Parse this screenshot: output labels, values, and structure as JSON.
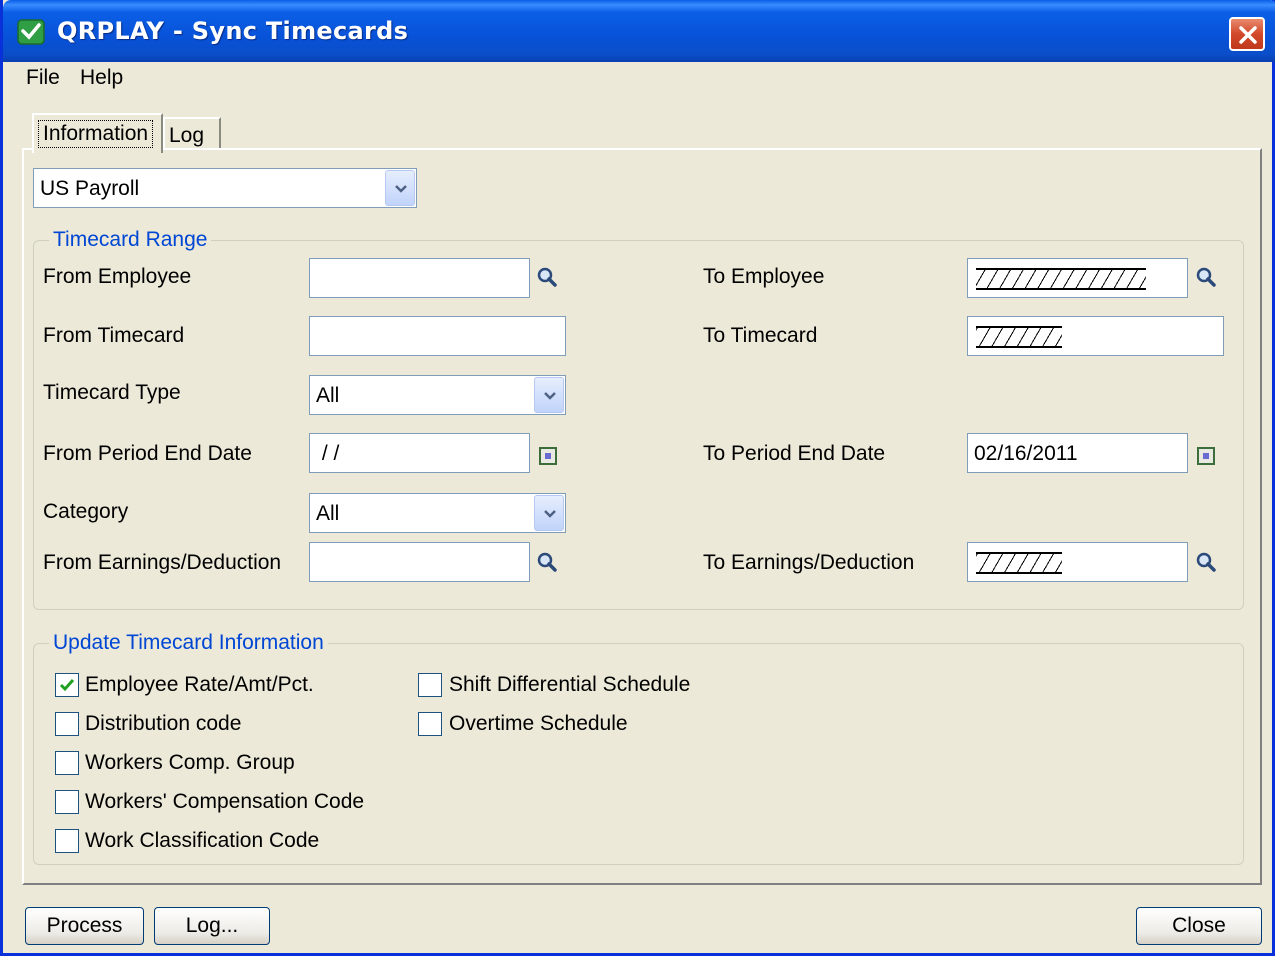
{
  "window": {
    "title": "QRPLAY - Sync Timecards",
    "app_icon": "sage-check-icon",
    "close_icon": "close-icon"
  },
  "menu": {
    "items": [
      "File",
      "Help"
    ]
  },
  "tabs": [
    {
      "label": "Information",
      "active": true
    },
    {
      "label": "Log",
      "active": false
    }
  ],
  "payroll_select": {
    "value": "US Payroll"
  },
  "timecard_range": {
    "legend": "Timecard Range",
    "from_employee": {
      "label": "From Employee",
      "value": ""
    },
    "to_employee": {
      "label": "To Employee",
      "value": "ZZZZZZZZZZZZ"
    },
    "from_timecard": {
      "label": "From Timecard",
      "value": ""
    },
    "to_timecard": {
      "label": "To Timecard",
      "value": "ZZZZZZ"
    },
    "timecard_type": {
      "label": "Timecard Type",
      "value": "All"
    },
    "from_period_end_date": {
      "label": "From Period End Date",
      "value": " / /"
    },
    "to_period_end_date": {
      "label": "To Period End Date",
      "value": "02/16/2011"
    },
    "category": {
      "label": "Category",
      "value": "All"
    },
    "from_earnings": {
      "label": "From Earnings/Deduction",
      "value": ""
    },
    "to_earnings": {
      "label": "To Earnings/Deduction",
      "value": "ZZZZZZ"
    }
  },
  "update_info": {
    "legend": "Update Timecard Information",
    "options": [
      {
        "label": "Employee Rate/Amt/Pct.",
        "checked": true
      },
      {
        "label": "Distribution code",
        "checked": false
      },
      {
        "label": "Workers Comp. Group",
        "checked": false
      },
      {
        "label": "Workers' Compensation Code",
        "checked": false
      },
      {
        "label": "Work Classification Code",
        "checked": false
      },
      {
        "label": "Shift Differential Schedule",
        "checked": false
      },
      {
        "label": "Overtime Schedule",
        "checked": false
      }
    ]
  },
  "buttons": {
    "process": "Process",
    "log": "Log...",
    "close": "Close"
  },
  "colors": {
    "title_bar": "#0a5fe6",
    "group_legend": "#0046d5",
    "window_bg": "#ece9d8"
  }
}
